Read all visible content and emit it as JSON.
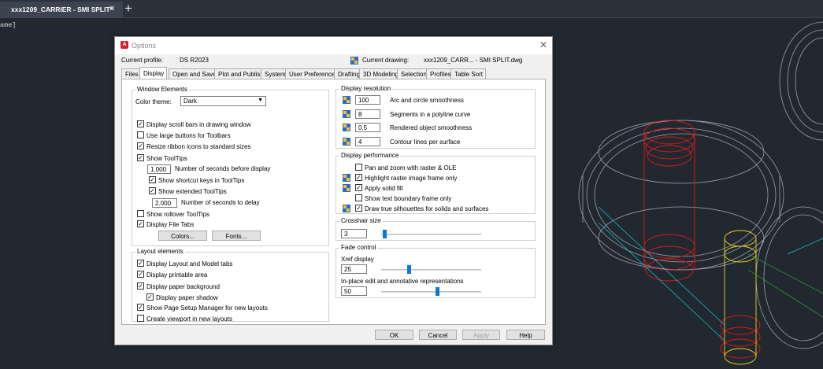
{
  "app_tabbar": {
    "doc_tab": "xxx1209_CARRIER - SMI SPLIT*",
    "close_glyph": "×",
    "new_tab_glyph": "+",
    "command_fragment": "ame]"
  },
  "dialog": {
    "title": "Options",
    "close_glyph": "✕",
    "current_profile_label": "Current profile:",
    "current_profile_value": "DS R2023",
    "current_drawing_label": "Current drawing:",
    "current_drawing_value": "xxx1209_CARR... - SMI SPLIT.dwg",
    "tabs": [
      "Files",
      "Display",
      "Open and Save",
      "Plot and Publish",
      "System",
      "User Preferences",
      "Drafting",
      "3D Modeling",
      "Selection",
      "Profiles",
      "Table Sort"
    ],
    "active_tab": "Display",
    "window_elements": {
      "title": "Window Elements",
      "color_theme_label": "Color theme:",
      "color_theme_value": "Dark",
      "scroll_bars": "Display scroll bars in drawing window",
      "large_buttons": "Use large buttons for Toolbars",
      "resize_ribbon": "Resize ribbon icons to standard sizes",
      "show_tooltips": "Show ToolTips",
      "seconds_before_value": "1.000",
      "seconds_before_label": "Number of seconds before display",
      "shortcut_keys": "Show shortcut keys in ToolTips",
      "extended_tooltips": "Show extended ToolTips",
      "seconds_delay_value": "2.000",
      "seconds_delay_label": "Number of seconds to delay",
      "rollover_tooltips": "Show rollover ToolTips",
      "file_tabs": "Display File Tabs",
      "colors_button": "Colors...",
      "fonts_button": "Fonts..."
    },
    "layout_elements": {
      "title": "Layout elements",
      "layout_model_tabs": "Display Layout and Model tabs",
      "printable_area": "Display printable area",
      "paper_background": "Display paper background",
      "paper_shadow": "Display paper shadow",
      "page_setup_manager": "Show Page Setup Manager for new layouts",
      "create_viewport": "Create viewport in new layouts"
    },
    "display_resolution": {
      "title": "Display resolution",
      "arc_value": "100",
      "arc_label": "Arc and circle smoothness",
      "segments_value": "8",
      "segments_label": "Segments in a polyline curve",
      "rendered_value": "0.5",
      "rendered_label": "Rendered object smoothness",
      "contour_value": "4",
      "contour_label": "Contour lines per surface"
    },
    "display_performance": {
      "title": "Display performance",
      "pan_zoom": "Pan and zoom with raster & OLE",
      "highlight_raster": "Highlight raster image frame only",
      "apply_solid_fill": "Apply solid fill",
      "text_boundary": "Show text boundary frame only",
      "true_silhouettes": "Draw true silhouettes for solids and surfaces"
    },
    "crosshair": {
      "title": "Crosshair size",
      "value": "3",
      "level": 3
    },
    "fade_control": {
      "title": "Fade control",
      "xref_label": "Xref display",
      "xref_value": "25",
      "xref_level": 25,
      "inplace_label": "In-place edit and annotative representations",
      "inplace_value": "50",
      "inplace_level": 50
    },
    "buttons": {
      "ok": "OK",
      "cancel": "Cancel",
      "apply": "Apply",
      "help": "Help"
    }
  }
}
